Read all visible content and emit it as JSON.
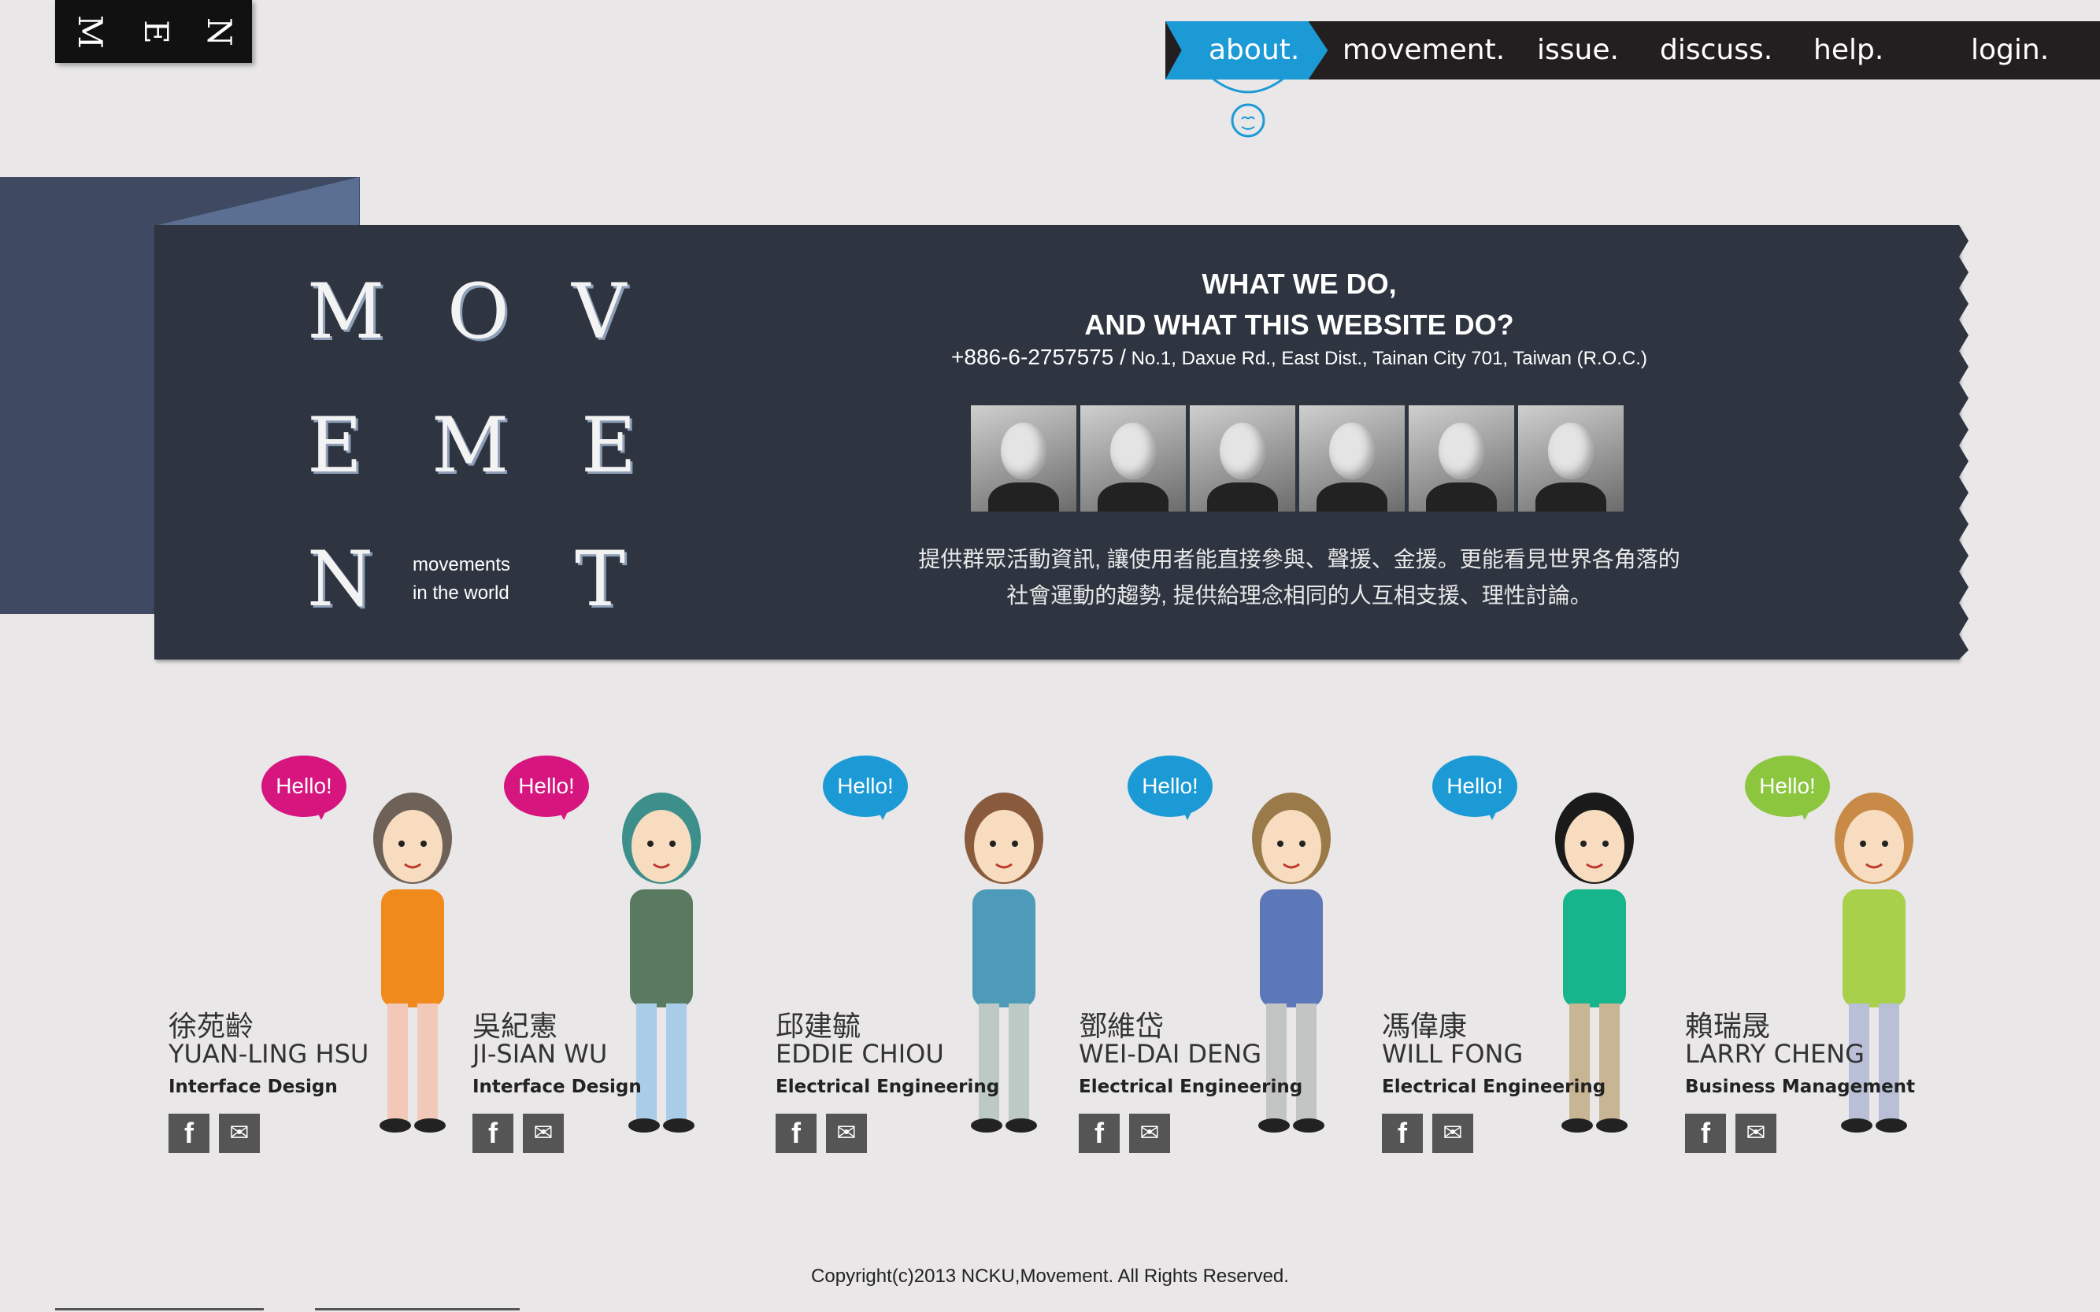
{
  "logo": {
    "letters": [
      "M",
      "E",
      "N"
    ]
  },
  "nav": {
    "items": [
      {
        "label": "about."
      },
      {
        "label": "movement."
      },
      {
        "label": "issue."
      },
      {
        "label": "discuss."
      },
      {
        "label": "help."
      },
      {
        "label": "login."
      }
    ],
    "active_color": "#1b9ad6"
  },
  "banner": {
    "letters": [
      "M",
      "O",
      "V",
      "E",
      "M",
      "E",
      "N",
      "T"
    ],
    "tagline_line1": "movements",
    "tagline_line2": "in the world",
    "heading_line1": "WHAT WE DO,",
    "heading_line2": "AND WHAT THIS WEBSITE DO?",
    "phone": "+886-6-2757575 /",
    "address": "No.1, Daxue Rd., East Dist., Tainan City 701, Taiwan (R.O.C.)",
    "mission_line1": "提供群眾活動資訊, 讓使用者能直接參與、聲援、金援。更能看見世界各角落的",
    "mission_line2": "社會運動的趨勢, 提供給理念相同的人互相支援、理性討論。",
    "background_color": "#2e3541"
  },
  "team": {
    "greeting": "Hello!",
    "facebook_icon_label": "f",
    "mail_icon_label": "✉",
    "members": [
      {
        "cn": "徐苑齡",
        "en": "YUAN-LING HSU",
        "dept": "Interface Design",
        "bubble_color": "#d6157e"
      },
      {
        "cn": "吳紀憲",
        "en": "JI-SIAN WU",
        "dept": "Interface Design",
        "bubble_color": "#d6157e"
      },
      {
        "cn": "邱建毓",
        "en": "EDDIE CHIOU",
        "dept": "Electrical Engineering",
        "bubble_color": "#1b9ad6"
      },
      {
        "cn": "鄧維岱",
        "en": "WEI-DAI DENG",
        "dept": "Electrical Engineering",
        "bubble_color": "#1b9ad6"
      },
      {
        "cn": "馮偉康",
        "en": "WILL FONG",
        "dept": "Electrical Engineering",
        "bubble_color": "#1b9ad6"
      },
      {
        "cn": "賴瑞晟",
        "en": "LARRY CHENG",
        "dept": "Business Management",
        "bubble_color": "#8cc63f"
      }
    ]
  },
  "footer": {
    "copyright": "Copyright(c)2013 NCKU,Movement. All Rights Reserved."
  }
}
